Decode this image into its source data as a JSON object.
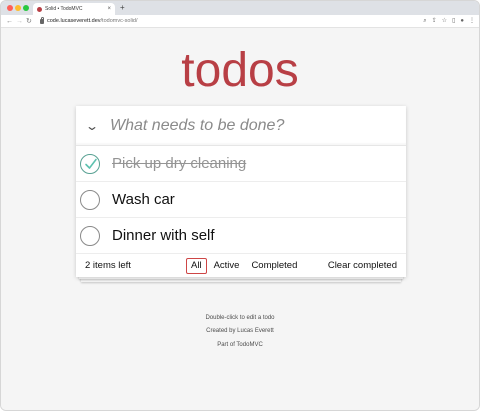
{
  "browser": {
    "tab_title": "Solid • TodoMVC",
    "tab_close": "×",
    "new_tab": "+",
    "url_host": "code.lucaseverett.dev",
    "url_path": "/todomvc-solid/"
  },
  "app": {
    "title": "todos",
    "new_todo_placeholder": "What needs to be done?",
    "toggle_all_icon": "❯"
  },
  "todos": [
    {
      "label": "Pick up dry cleaning",
      "completed": true
    },
    {
      "label": "Wash car",
      "completed": false
    },
    {
      "label": "Dinner with self",
      "completed": false
    }
  ],
  "footer": {
    "count": "2 items left",
    "filters": [
      "All",
      "Active",
      "Completed"
    ],
    "selected_filter": "All",
    "clear_completed": "Clear completed"
  },
  "info": {
    "line1": "Double-click to edit a todo",
    "line2": "Created by Lucas Everett",
    "line3": "Part of TodoMVC"
  },
  "colors": {
    "title": "#b83f45",
    "check": "#5dc2af",
    "selected_border": "#ce4646"
  }
}
